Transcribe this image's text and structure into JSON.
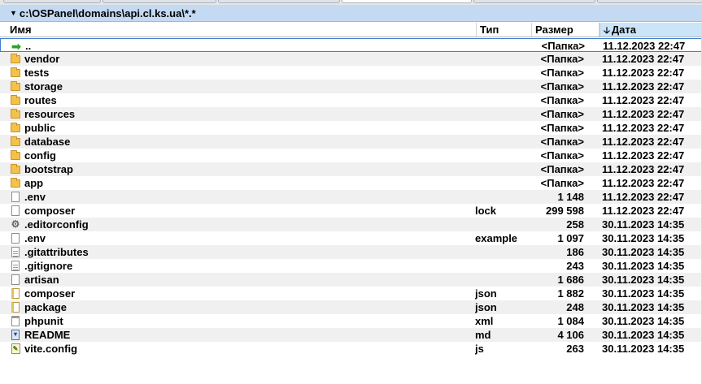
{
  "path_bar": {
    "path": "c:\\OSPanel\\domains\\api.cl.ks.ua\\*.*"
  },
  "columns": {
    "name": "Имя",
    "type": "Тип",
    "size": "Размер",
    "date": "Дата",
    "sorted_by": "date"
  },
  "rows": [
    {
      "icon": "up-arrow-icon",
      "name": "..",
      "ext": "",
      "size": "<Папка>",
      "date": "11.12.2023 22:47"
    },
    {
      "icon": "folder-icon",
      "name": "vendor",
      "ext": "",
      "size": "<Папка>",
      "date": "11.12.2023 22:47"
    },
    {
      "icon": "folder-icon",
      "name": "tests",
      "ext": "",
      "size": "<Папка>",
      "date": "11.12.2023 22:47"
    },
    {
      "icon": "folder-icon",
      "name": "storage",
      "ext": "",
      "size": "<Папка>",
      "date": "11.12.2023 22:47"
    },
    {
      "icon": "folder-icon",
      "name": "routes",
      "ext": "",
      "size": "<Папка>",
      "date": "11.12.2023 22:47"
    },
    {
      "icon": "folder-icon",
      "name": "resources",
      "ext": "",
      "size": "<Папка>",
      "date": "11.12.2023 22:47"
    },
    {
      "icon": "folder-icon",
      "name": "public",
      "ext": "",
      "size": "<Папка>",
      "date": "11.12.2023 22:47"
    },
    {
      "icon": "folder-icon",
      "name": "database",
      "ext": "",
      "size": "<Папка>",
      "date": "11.12.2023 22:47"
    },
    {
      "icon": "folder-icon",
      "name": "config",
      "ext": "",
      "size": "<Папка>",
      "date": "11.12.2023 22:47"
    },
    {
      "icon": "folder-icon",
      "name": "bootstrap",
      "ext": "",
      "size": "<Папка>",
      "date": "11.12.2023 22:47"
    },
    {
      "icon": "folder-icon",
      "name": "app",
      "ext": "",
      "size": "<Папка>",
      "date": "11.12.2023 22:47"
    },
    {
      "icon": "file-icon",
      "name": ".env",
      "ext": "",
      "size": "1 148",
      "date": "11.12.2023 22:47"
    },
    {
      "icon": "file-icon",
      "name": "composer",
      "ext": "lock",
      "size": "299 598",
      "date": "11.12.2023 22:47"
    },
    {
      "icon": "gear-icon",
      "name": ".editorconfig",
      "ext": "",
      "size": "258",
      "date": "30.11.2023 14:35"
    },
    {
      "icon": "file-icon",
      "name": ".env",
      "ext": "example",
      "size": "1 097",
      "date": "30.11.2023 14:35"
    },
    {
      "icon": "text-file-icon",
      "name": ".gitattributes",
      "ext": "",
      "size": "186",
      "date": "30.11.2023 14:35"
    },
    {
      "icon": "text-file-icon",
      "name": ".gitignore",
      "ext": "",
      "size": "243",
      "date": "30.11.2023 14:35"
    },
    {
      "icon": "file-icon",
      "name": "artisan",
      "ext": "",
      "size": "1 686",
      "date": "30.11.2023 14:35"
    },
    {
      "icon": "json-file-icon",
      "name": "composer",
      "ext": "json",
      "size": "1 882",
      "date": "30.11.2023 14:35"
    },
    {
      "icon": "json-file-icon",
      "name": "package",
      "ext": "json",
      "size": "248",
      "date": "30.11.2023 14:35"
    },
    {
      "icon": "xml-file-icon",
      "name": "phpunit",
      "ext": "xml",
      "size": "1 084",
      "date": "30.11.2023 14:35"
    },
    {
      "icon": "readme-file-icon",
      "name": "README",
      "ext": "md",
      "size": "4 106",
      "date": "30.11.2023 14:35"
    },
    {
      "icon": "js-file-icon",
      "name": "vite.config",
      "ext": "js",
      "size": "263",
      "date": "30.11.2023 14:35"
    }
  ]
}
